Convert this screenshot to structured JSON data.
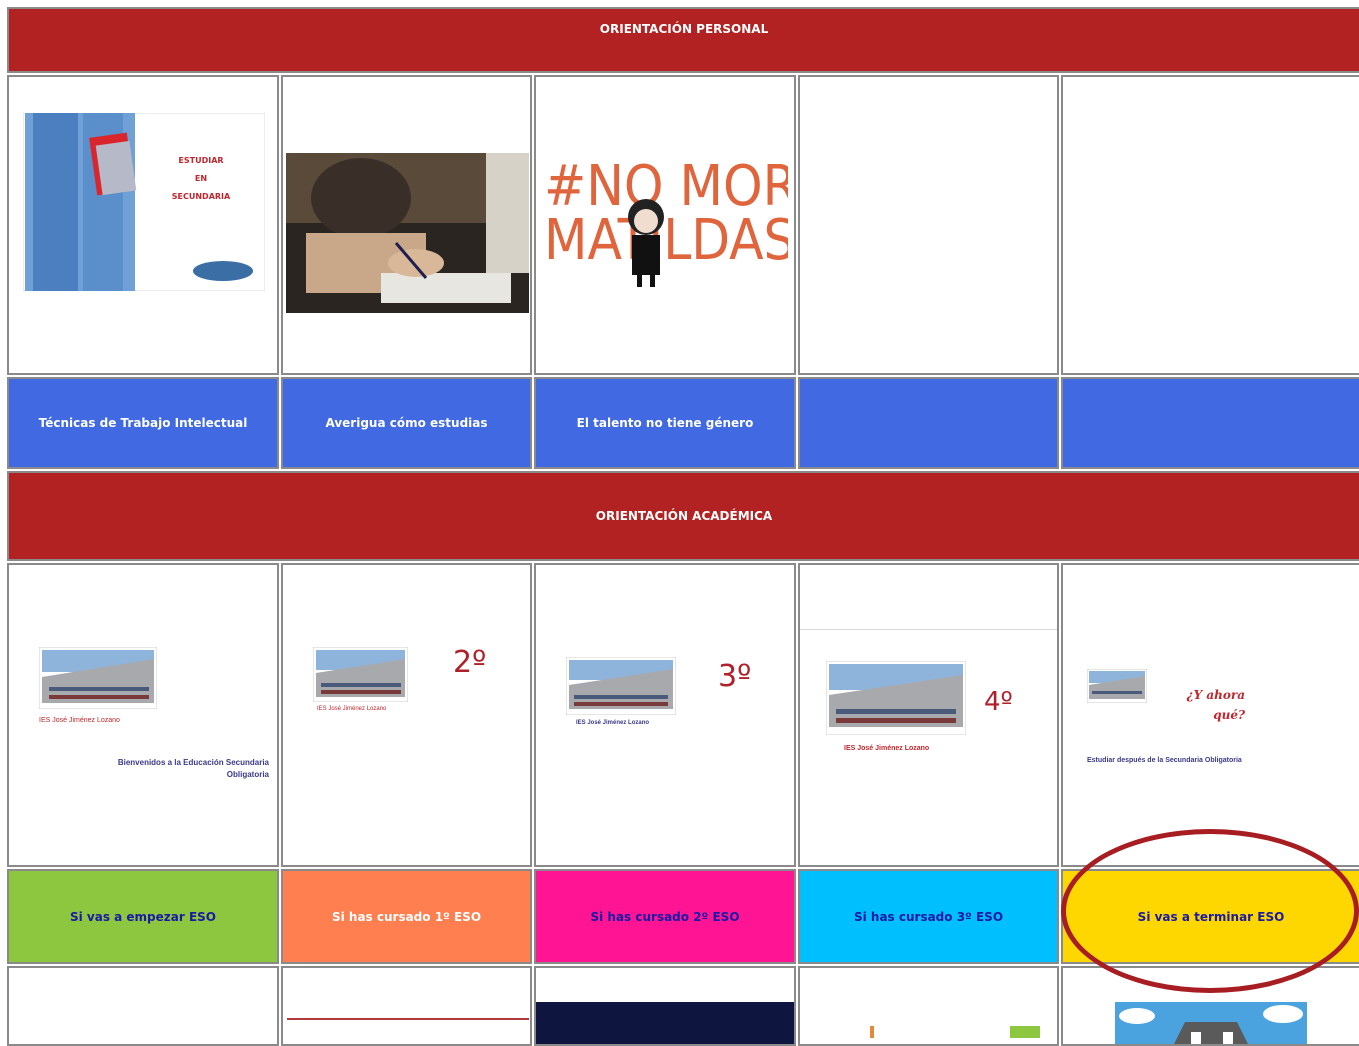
{
  "personal": {
    "header": "ORIENTACIÓN PERSONAL",
    "cards": [
      {
        "label": "Técnicas de Trabajo Intelectual",
        "img_text": [
          "ESTUDIAR",
          "EN",
          "SECUNDARIA"
        ]
      },
      {
        "label": "Averigua cómo estudias"
      },
      {
        "label": "El talento no tiene género",
        "img_text": [
          "#NO MORE",
          "MATILDAS"
        ]
      },
      {
        "label": ""
      },
      {
        "label": ""
      }
    ]
  },
  "academica": {
    "header": "ORIENTACIÓN ACADÉMICA",
    "cards": [
      {
        "label": "Si vas a empezar ESO",
        "color": "#8dc63f",
        "text_color": "#1a1aa6",
        "img_text": {
          "school": "IES José Jiménez Lozano",
          "title": "Bienvenidos a la Educación Secundaria Obligatoria"
        }
      },
      {
        "label": "Si has cursado 1º ESO",
        "color": "#ff7f50",
        "text_color": "#ffffff",
        "img_text": {
          "grade": "2º",
          "school": "IES José Jiménez Lozano"
        }
      },
      {
        "label": "Si has cursado 2º ESO",
        "color": "#ff1493",
        "text_color": "#1a1aa6",
        "img_text": {
          "grade": "3º",
          "school": "IES José Jiménez Lozano"
        }
      },
      {
        "label": "Si has cursado 3º ESO",
        "color": "#00bfff",
        "text_color": "#1a1aa6",
        "img_text": {
          "grade": "4º",
          "school": "IES José Jiménez Lozano"
        }
      },
      {
        "label": "Si vas a terminar ESO",
        "color": "#ffd700",
        "text_color": "#1a1aa6",
        "img_text": {
          "question": "¿Y ahora qué?",
          "title": "Estudiar después de la Secundaria Obligatoria"
        }
      }
    ]
  },
  "colors": {
    "header_bg": "#b32222",
    "label_blue": "#4169e1",
    "highlight_ellipse": "#a81d22"
  }
}
